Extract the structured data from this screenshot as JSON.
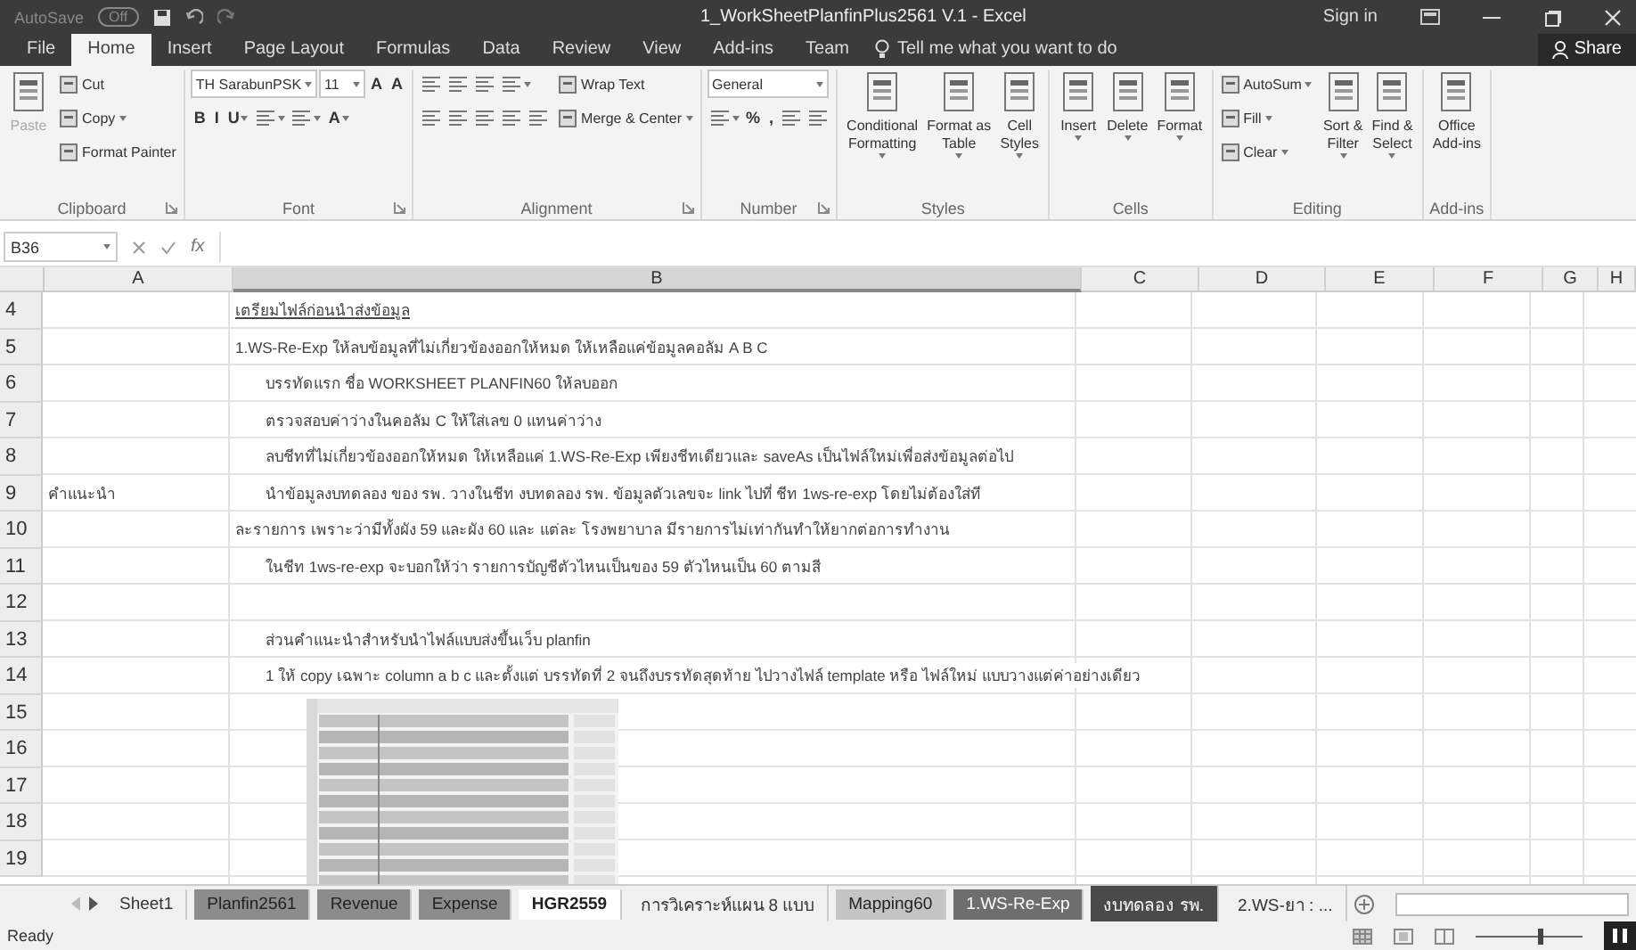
{
  "title_bar": {
    "autosave": "AutoSave",
    "autosave_state": "Off",
    "title": "1_WorkSheetPlanfinPlus2561 V.1 - Excel",
    "sign_in": "Sign in"
  },
  "menu_tabs": [
    {
      "label": "File",
      "selected": false
    },
    {
      "label": "Home",
      "selected": true
    },
    {
      "label": "Insert",
      "selected": false
    },
    {
      "label": "Page Layout",
      "selected": false
    },
    {
      "label": "Formulas",
      "selected": false
    },
    {
      "label": "Data",
      "selected": false
    },
    {
      "label": "Review",
      "selected": false
    },
    {
      "label": "View",
      "selected": false
    },
    {
      "label": "Add-ins",
      "selected": false
    },
    {
      "label": "Team",
      "selected": false
    }
  ],
  "tell_me": "Tell me what you want to do",
  "share": "Share",
  "ribbon_groups": [
    {
      "label": "Clipboard",
      "launcher": true,
      "columns": [
        [
          [
            {
              "kind": "big",
              "label": [
                "Paste"
              ],
              "disabled": true
            }
          ]
        ],
        [
          [
            {
              "kind": "small",
              "label": "Cut"
            }
          ],
          [
            {
              "kind": "small",
              "label": "Copy",
              "dropdown": true
            }
          ],
          [
            {
              "kind": "small",
              "label": "Format Painter"
            }
          ]
        ]
      ]
    },
    {
      "label": "Font",
      "launcher": true,
      "columns": [
        [
          [
            {
              "kind": "field",
              "value": "TH SarabunPSK",
              "wide": true
            },
            {
              "kind": "field",
              "value": "11"
            },
            {
              "kind": "glyph",
              "label": "A"
            },
            {
              "kind": "glyph",
              "label": "A"
            }
          ],
          [
            {
              "kind": "glyph",
              "label": "B"
            },
            {
              "kind": "glyph",
              "label": "I"
            },
            {
              "kind": "glyph",
              "label": "U",
              "dropdown": true
            },
            {
              "kind": "icon",
              "dropdown": true
            },
            {
              "kind": "icon",
              "dropdown": true
            },
            {
              "kind": "glyph",
              "label": "A",
              "dropdown": true
            }
          ]
        ]
      ]
    },
    {
      "label": "Alignment",
      "launcher": true,
      "columns": [
        [
          [
            {
              "kind": "icon"
            },
            {
              "kind": "icon"
            },
            {
              "kind": "icon"
            },
            {
              "kind": "icon",
              "dropdown": true
            }
          ],
          [
            {
              "kind": "icon"
            },
            {
              "kind": "icon"
            },
            {
              "kind": "icon"
            },
            {
              "kind": "icon"
            },
            {
              "kind": "icon"
            }
          ]
        ],
        [
          [
            {
              "kind": "small",
              "label": "Wrap Text"
            }
          ],
          [
            {
              "kind": "small",
              "label": "Merge & Center",
              "dropdown": true
            }
          ]
        ]
      ]
    },
    {
      "label": "Number",
      "launcher": true,
      "columns": [
        [
          [
            {
              "kind": "field",
              "value": "General",
              "wide": true
            }
          ],
          [
            {
              "kind": "icon",
              "dropdown": true
            },
            {
              "kind": "glyph",
              "label": "%"
            },
            {
              "kind": "glyph",
              "label": ","
            },
            {
              "kind": "icon"
            },
            {
              "kind": "icon"
            }
          ]
        ]
      ]
    },
    {
      "label": "Styles",
      "columns": [
        [
          [
            {
              "kind": "big",
              "label": [
                "Conditional",
                "Formatting"
              ],
              "dropdown": true
            },
            {
              "kind": "big",
              "label": [
                "Format as",
                "Table"
              ],
              "dropdown": true
            },
            {
              "kind": "big",
              "label": [
                "Cell",
                "Styles"
              ],
              "dropdown": true
            }
          ]
        ]
      ]
    },
    {
      "label": "Cells",
      "columns": [
        [
          [
            {
              "kind": "big",
              "label": [
                "Insert"
              ],
              "dropdown": true
            },
            {
              "kind": "big",
              "label": [
                "Delete"
              ],
              "dropdown": true
            },
            {
              "kind": "big",
              "label": [
                "Format"
              ],
              "dropdown": true
            }
          ]
        ]
      ]
    },
    {
      "label": "Editing",
      "columns": [
        [
          [
            {
              "kind": "small",
              "label": "AutoSum",
              "dropdown": true
            }
          ],
          [
            {
              "kind": "small",
              "label": "Fill",
              "dropdown": true
            }
          ],
          [
            {
              "kind": "small",
              "label": "Clear",
              "dropdown": true
            }
          ]
        ],
        [
          [
            {
              "kind": "big",
              "label": [
                "Sort &",
                "Filter"
              ],
              "dropdown": true
            },
            {
              "kind": "big",
              "label": [
                "Find &",
                "Select"
              ],
              "dropdown": true
            }
          ]
        ]
      ]
    },
    {
      "label": "Add-ins",
      "columns": [
        [
          [
            {
              "kind": "big",
              "label": [
                "Office",
                "Add-ins"
              ]
            }
          ]
        ]
      ]
    }
  ],
  "formula_bar": {
    "name_box": "B36",
    "fx": "fx"
  },
  "columns": [
    "A",
    "B",
    "C",
    "D",
    "E",
    "F",
    "G",
    "H"
  ],
  "rows": [
    {
      "number": "4",
      "a": "",
      "b": "เตรียมไฟล์ก่อนนำส่งข้อมูล",
      "underline": true,
      "indented": false
    },
    {
      "number": "5",
      "a": "",
      "b": "1.WS-Re-Exp ให้ลบข้อมูลที่ไม่เกี่ยวข้องออกให้หมด   ให้เหลือแค่ข้อมูลคอลัม A B C",
      "underline": false,
      "indented": false
    },
    {
      "number": "6",
      "a": "",
      "b": "บรรทัดแรก ชื่อ WORKSHEET PLANFIN60  ให้ลบออก",
      "underline": false,
      "indented": true
    },
    {
      "number": "7",
      "a": "",
      "b": "ตรวจสอบค่าว่างในคอลัม C  ให้ใส่เลข  0  แทนค่าว่าง",
      "underline": false,
      "indented": true
    },
    {
      "number": "8",
      "a": "",
      "b": "ลบชีทที่ไม่เกี่ยวข้องออกให้หมด  ให้เหลือแค่  1.WS-Re-Exp  เพียงชีทเดียวและ saveAs  เป็นไฟล์ใหม่เพื่อส่งข้อมูลต่อไป",
      "underline": false,
      "indented": true
    },
    {
      "number": "9",
      "a": "คำแนะนำ",
      "b": "นำข้อมูลงบทดลอง ของ  รพ.  วางในชีท  งบทดลอง รพ.     ข้อมูลตัวเลขจะ link  ไปที่  ชีท  1ws-re-exp  โดยไม่ต้องใส่ที",
      "underline": false,
      "indented": true
    },
    {
      "number": "10",
      "a": "",
      "b": "ละรายการ  เพราะว่ามีทั้งผัง 59  และผัง 60   และ แต่ละ โรงพยาบาล มีรายการไม่เท่ากันทำให้ยากต่อการทำงาน",
      "underline": false,
      "indented": false
    },
    {
      "number": "11",
      "a": "",
      "b": "ในชีท 1ws-re-exp  จะบอกให้ว่า รายการบัญชีตัวไหนเป็นของ 59  ตัวไหนเป็น 60  ตามสี",
      "underline": false,
      "indented": true
    },
    {
      "number": "12"
    },
    {
      "number": "13",
      "a": "",
      "b": "ส่วนคำแนะนำสำหรับนำไฟล์แบบส่งขึ้นเว็บ planfin",
      "underline": false,
      "indented": true
    },
    {
      "number": "14",
      "a": "",
      "b": "1  ให้ copy เฉพาะ  column a b c และตั้งแต่ บรรทัดที่ 2 จนถึงบรรทัดสุดท้าย ไปวางไฟล์ template หรือ ไฟล์ใหม่ แบบวางแต่ค่าอย่างเดียว",
      "underline": false,
      "indented": true
    },
    {
      "number": "15"
    },
    {
      "number": "16"
    },
    {
      "number": "17"
    },
    {
      "number": "18"
    },
    {
      "number": "19"
    }
  ],
  "sheet_tabs": [
    {
      "label": "Sheet1",
      "selected": false
    },
    {
      "label": "Planfin2561",
      "selected": false,
      "color": "#8c8c8c"
    },
    {
      "label": "Revenue",
      "selected": false,
      "color": "#8c8c8c"
    },
    {
      "label": "Expense",
      "selected": false,
      "color": "#8c8c8c"
    },
    {
      "label": "HGR2559",
      "selected": true
    },
    {
      "label": "การวิเคราะห์แผน 8 แบบ",
      "selected": false
    },
    {
      "label": "Mapping60",
      "selected": false,
      "color": "#c4c4c4"
    },
    {
      "label": "1.WS-Re-Exp",
      "selected": false,
      "color": "#6e6e6e"
    },
    {
      "label": "งบทดลอง รพ.",
      "selected": false,
      "color": "#4a4a4a"
    },
    {
      "label": "2.WS-ยา : ...",
      "selected": false
    }
  ],
  "status": "Ready",
  "zoom_slider": {
    "level": 0.6
  }
}
